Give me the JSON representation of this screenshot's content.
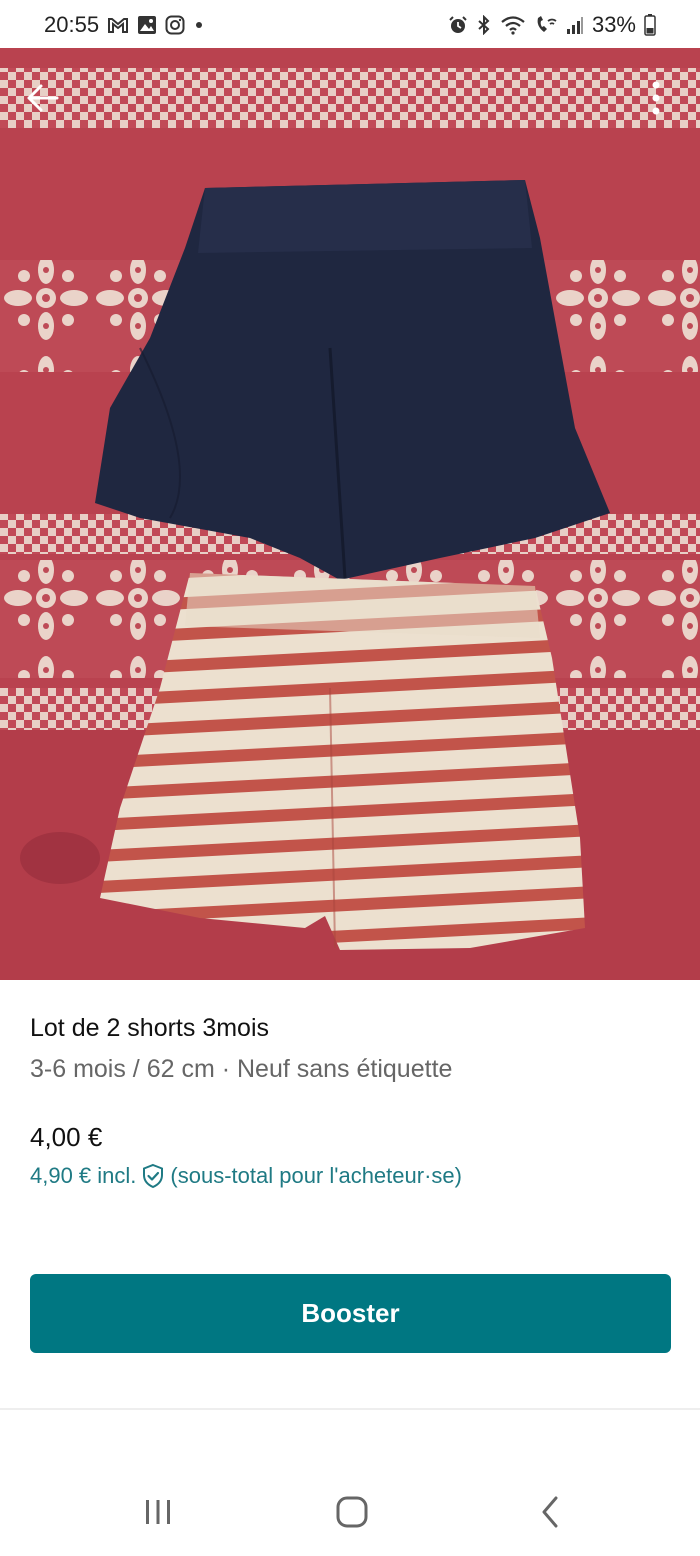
{
  "status_bar": {
    "time": "20:55",
    "battery": "33%",
    "left_icons": [
      "gmail-icon",
      "gallery-icon",
      "instagram-icon",
      "dot-icon"
    ],
    "right_icons": [
      "alarm-icon",
      "bluetooth-icon",
      "wifi-icon",
      "wifi-call-icon",
      "signal-icon",
      "battery-icon"
    ]
  },
  "photo": {
    "description_icons": [
      "back-arrow-icon",
      "more-vertical-icon"
    ]
  },
  "listing": {
    "title": "Lot de 2 shorts 3mois",
    "subtitle": "3-6 mois / 62 cm · Neuf sans étiquette",
    "price": "4,00 €",
    "price_incl": "4,90 € incl.",
    "price_note": "(sous-total pour l'acheteur·se)"
  },
  "actions": {
    "booster_label": "Booster"
  },
  "colors": {
    "accent": "#007782",
    "link": "#1f7a84"
  }
}
